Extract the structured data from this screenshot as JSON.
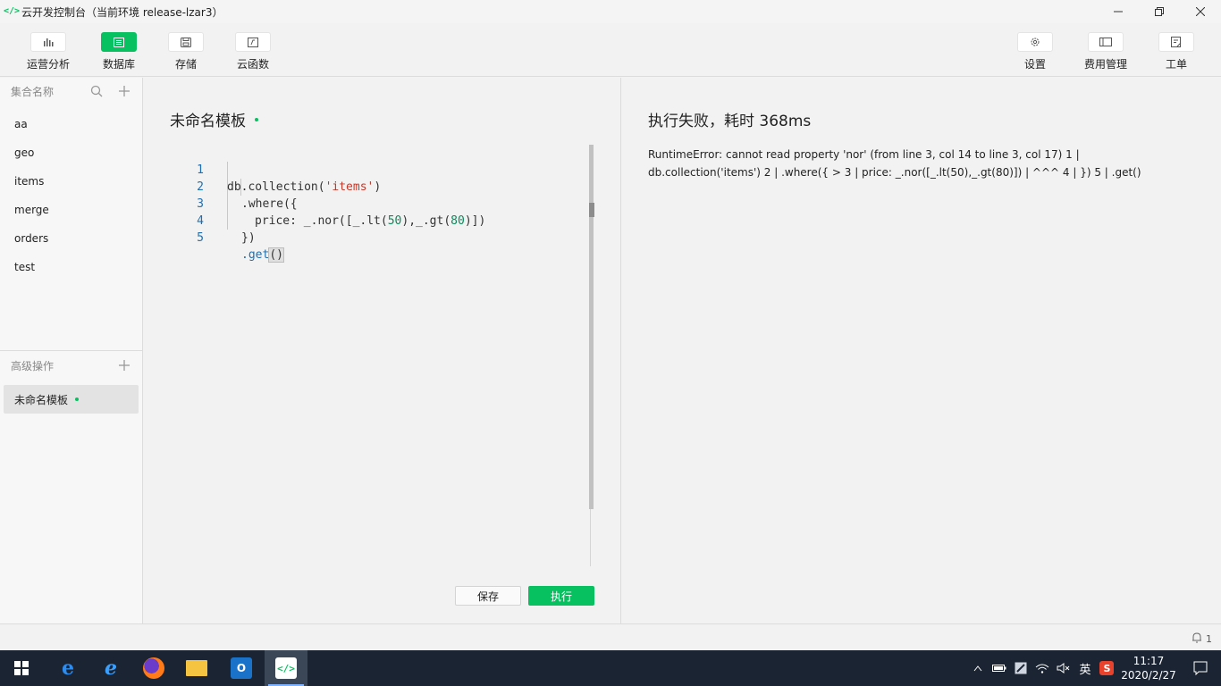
{
  "window": {
    "title": "云开发控制台（当前环境 release-lzar3）"
  },
  "toolbar": {
    "left": [
      {
        "label": "运营分析",
        "icon": "bar-chart-icon"
      },
      {
        "label": "数据库",
        "icon": "database-icon",
        "active": true
      },
      {
        "label": "存储",
        "icon": "storage-icon"
      },
      {
        "label": "云函数",
        "icon": "cloud-function-icon"
      }
    ],
    "right": [
      {
        "label": "设置",
        "icon": "gear-icon"
      },
      {
        "label": "费用管理",
        "icon": "billing-icon"
      },
      {
        "label": "工单",
        "icon": "ticket-icon"
      }
    ]
  },
  "sidebar": {
    "collections_header": "集合名称",
    "collections": [
      "aa",
      "geo",
      "items",
      "merge",
      "orders",
      "test"
    ],
    "advanced_header": "高级操作",
    "templates": [
      {
        "name": "未命名模板"
      }
    ]
  },
  "editor": {
    "title": "未命名模板",
    "lines": [
      {
        "n": "1"
      },
      {
        "n": "2"
      },
      {
        "n": "3"
      },
      {
        "n": "4"
      },
      {
        "n": "5"
      }
    ],
    "code_line1_a": "db.collection(",
    "code_line1_str": "'items'",
    "code_line1_b": ")",
    "code_line2": ".where({",
    "code_line3_a": "price: _.nor([_.lt(",
    "code_line3_n1": "50",
    "code_line3_b": "),_.gt(",
    "code_line3_n2": "80",
    "code_line3_c": ")])",
    "code_line4": "})",
    "code_line5_a": ".get",
    "code_line5_b": "()",
    "save_label": "保存",
    "run_label": "执行"
  },
  "result": {
    "title": "执行失败，耗时 368ms",
    "message": "RuntimeError: cannot read property 'nor' (from line 3, col 14 to line 3, col 17) 1 | db.collection('items') 2 | .where({ > 3 | price: _.nor([_.lt(50),_.gt(80)]) | ^^^ 4 | }) 5 | .get()"
  },
  "statusbar": {
    "notifications": "1"
  },
  "taskbar": {
    "time": "11:17",
    "date": "2020/2/27",
    "ime": "英"
  },
  "colors": {
    "accent": "#07c160",
    "taskbar": "#1b2433"
  }
}
